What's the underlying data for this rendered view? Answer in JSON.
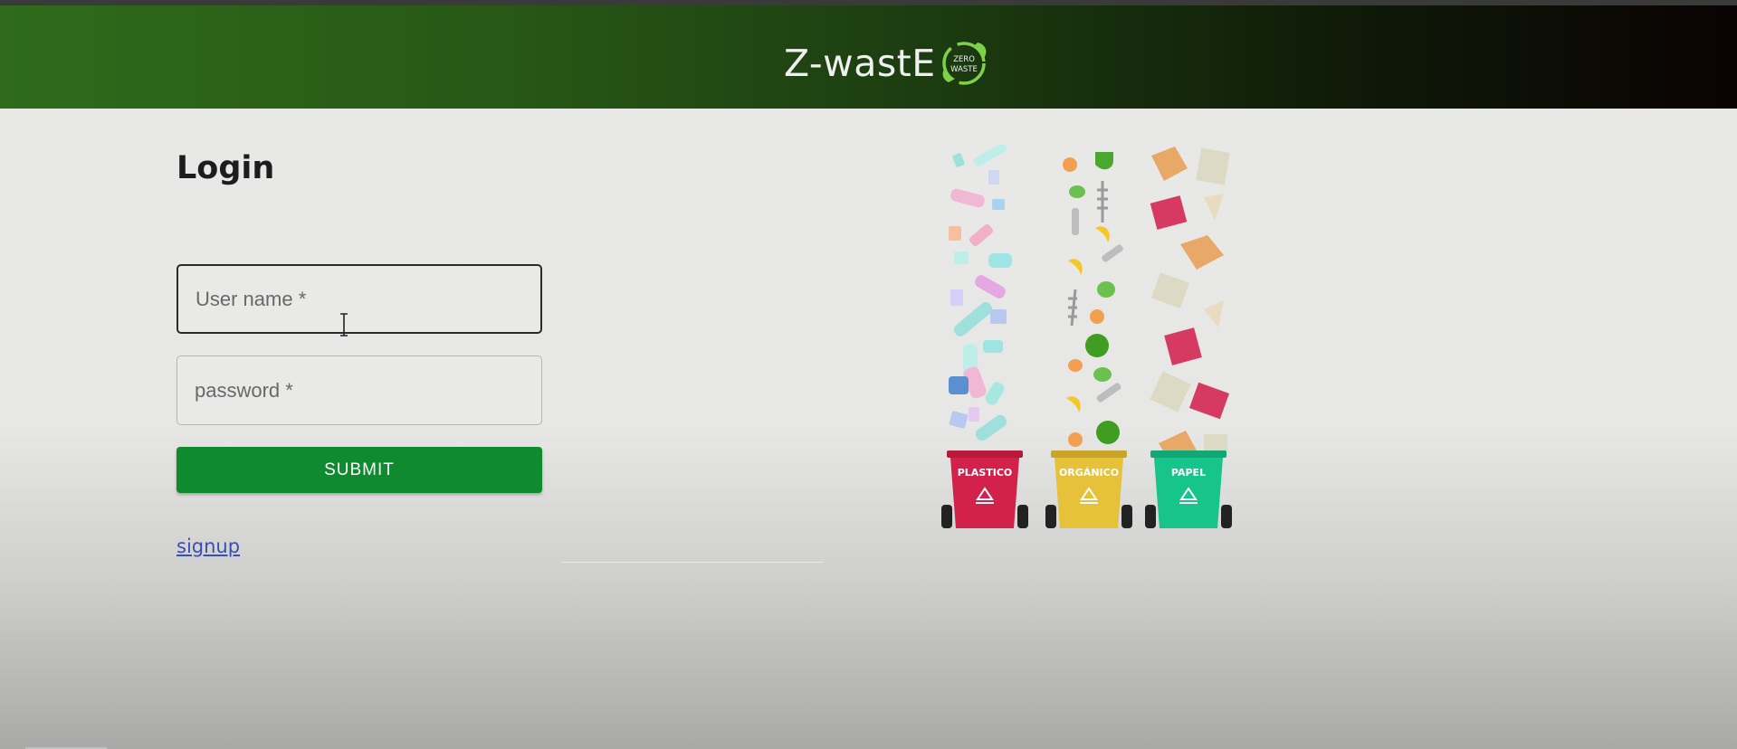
{
  "header": {
    "brand_text": "Z-wastE",
    "logo_badge_line1": "ZERO",
    "logo_badge_line2": "WASTE",
    "logo_icon": "recycle-leaf-logo-icon"
  },
  "login": {
    "title": "Login",
    "username_placeholder": "User name *",
    "password_placeholder": "password *",
    "submit_label": "SUBMIT",
    "signup_link": "signup"
  },
  "illustration": {
    "bins": [
      {
        "label": "PLASTICO",
        "color": "#d2214a"
      },
      {
        "label": "ORGÁNICO",
        "color": "#e6c13a"
      },
      {
        "label": "PAPEL",
        "color": "#17c48a"
      }
    ]
  },
  "colors": {
    "header_start": "#2f6b1b",
    "header_end": "#0a0203",
    "submit": "#0f8a2e",
    "link": "#3a4fb5"
  }
}
